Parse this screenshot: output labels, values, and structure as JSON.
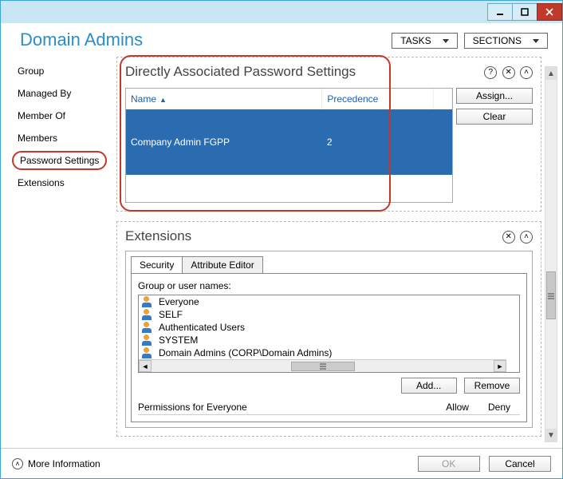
{
  "header": {
    "title": "Domain Admins",
    "tasks_label": "TASKS",
    "sections_label": "SECTIONS"
  },
  "sidebar": {
    "items": [
      {
        "label": "Group"
      },
      {
        "label": "Managed By"
      },
      {
        "label": "Member Of"
      },
      {
        "label": "Members"
      },
      {
        "label": "Password Settings",
        "selected": true
      },
      {
        "label": "Extensions"
      }
    ]
  },
  "password_section": {
    "title": "Directly Associated Password Settings",
    "columns": {
      "name": "Name",
      "precedence": "Precedence"
    },
    "rows": [
      {
        "name": "Company Admin FGPP",
        "precedence": "2"
      }
    ],
    "assign": "Assign...",
    "clear": "Clear"
  },
  "extensions_section": {
    "title": "Extensions",
    "tabs": {
      "security": "Security",
      "attribute_editor": "Attribute Editor"
    },
    "group_label": "Group or user names:",
    "acl": [
      "Everyone",
      "SELF",
      "Authenticated Users",
      "SYSTEM",
      "Domain Admins (CORP\\Domain Admins)"
    ],
    "add": "Add...",
    "remove": "Remove",
    "perm_label": "Permissions for Everyone",
    "allow": "Allow",
    "deny": "Deny"
  },
  "footer": {
    "more_info": "More Information",
    "ok": "OK",
    "cancel": "Cancel"
  }
}
